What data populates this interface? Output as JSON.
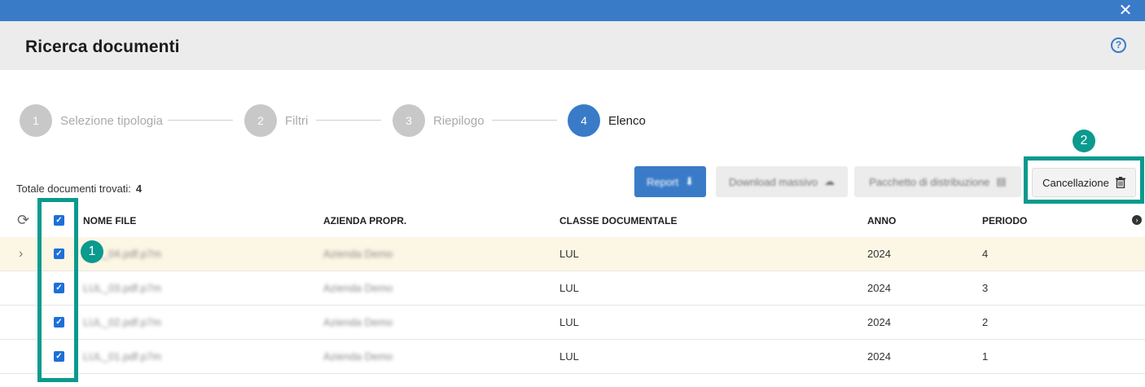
{
  "window": {
    "title": "Ricerca documenti",
    "close_icon": "✕",
    "help_icon": "?"
  },
  "steps": [
    {
      "number": "1",
      "label": "Selezione tipologia",
      "active": false
    },
    {
      "number": "2",
      "label": "Filtri",
      "active": false
    },
    {
      "number": "3",
      "label": "Riepilogo",
      "active": false
    },
    {
      "number": "4",
      "label": "Elenco",
      "active": true
    }
  ],
  "summary": {
    "label": "Totale documenti trovati:",
    "count": "4"
  },
  "toolbar": {
    "report_label": "Report",
    "download_label": "Download massivo",
    "pacchetto_label": "Pacchetto di distribuzione",
    "cancel_label": "Cancellazione"
  },
  "annotations": {
    "badge_1": "1",
    "badge_2": "2",
    "color": "#0a9a8e"
  },
  "table": {
    "columns": [
      "NOME FILE",
      "AZIENDA PROPR.",
      "CLASSE DOCUMENTALE",
      "ANNO",
      "PERIODO"
    ],
    "rows": [
      {
        "file": "LUL_04.pdf.p7m",
        "azienda": "Azienda Demo",
        "classe": "LUL",
        "anno": "2024",
        "periodo": "4",
        "selected": true
      },
      {
        "file": "LUL_03.pdf.p7m",
        "azienda": "Azienda Demo",
        "classe": "LUL",
        "anno": "2024",
        "periodo": "3",
        "selected": false
      },
      {
        "file": "LUL_02.pdf.p7m",
        "azienda": "Azienda Demo",
        "classe": "LUL",
        "anno": "2024",
        "periodo": "2",
        "selected": false
      },
      {
        "file": "LUL_01.pdf.p7m",
        "azienda": "Azienda Demo",
        "classe": "LUL",
        "anno": "2024",
        "periodo": "1",
        "selected": false
      }
    ]
  },
  "colors": {
    "primary": "#3a7bc8",
    "checkbox": "#1e6fd9",
    "selected_row": "#fcf6e4"
  }
}
